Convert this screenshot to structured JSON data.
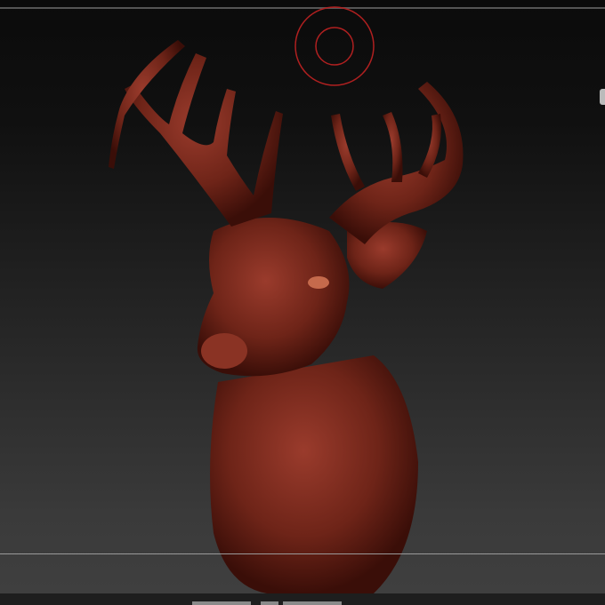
{
  "viewport": {
    "model": "deer-head-sculpt",
    "colors": {
      "material": "#7a2a1e",
      "material_highlight": "#b5503c",
      "brush_cursor": "#b02020",
      "background_top": "#0b0b0b",
      "background_bottom": "#404040"
    }
  }
}
